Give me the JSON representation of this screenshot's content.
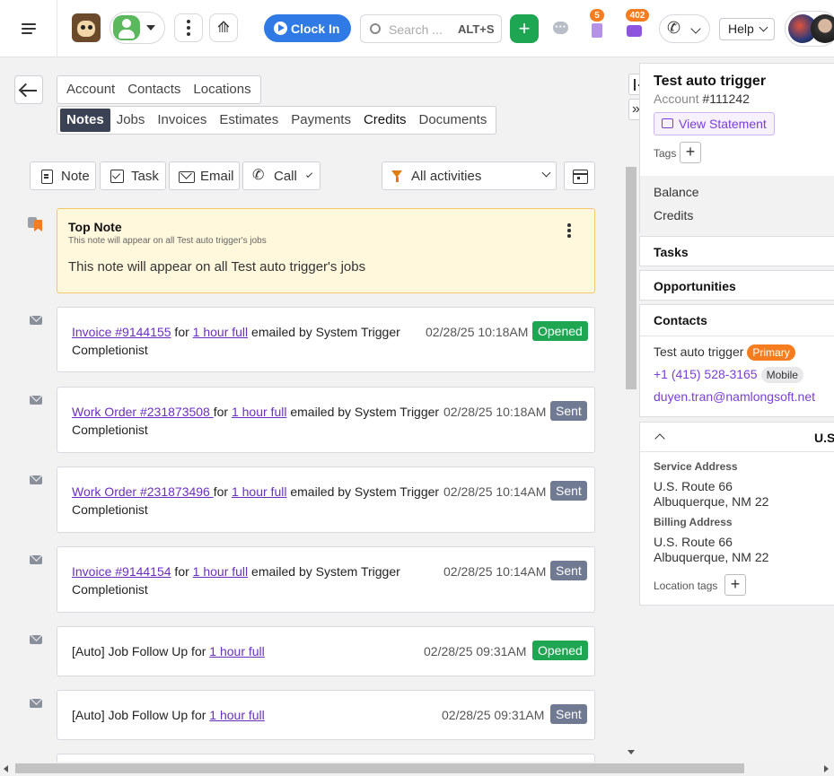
{
  "header": {
    "search_placeholder": "Search ...",
    "search_shortcut": "ALT+S",
    "clock_in": "Clock In",
    "tasks_badge": "5",
    "inbox_badge": "402",
    "help": "Help"
  },
  "tabs_primary": [
    "Account",
    "Contacts",
    "Locations"
  ],
  "tabs_secondary": [
    "Notes",
    "Jobs",
    "Invoices",
    "Estimates",
    "Payments",
    "Credits",
    "Documents"
  ],
  "actions": {
    "note": "Note",
    "task": "Task",
    "email": "Email",
    "call": "Call",
    "filter": "All activities"
  },
  "top_note": {
    "title": "Top Note",
    "subtitle": "This note will appear on all Test auto trigger's jobs",
    "body": "This note will appear on all Test auto trigger's jobs"
  },
  "activities": [
    {
      "link": "Invoice #9144155",
      "for": " for ",
      "link2": "1 hour full",
      "rest": " emailed by System Trigger",
      "line2": "Completionist",
      "time": "02/28/25 10:18AM",
      "status": "Opened"
    },
    {
      "link": "Work Order #231873508 ",
      "for": "for ",
      "link2": "1 hour full",
      "rest": " emailed by System Trigger",
      "line2": "Completionist",
      "time": "02/28/25 10:18AM",
      "status": "Sent"
    },
    {
      "link": "Work Order #231873496 ",
      "for": "for ",
      "link2": "1 hour full",
      "rest": " emailed by System Trigger",
      "line2": "Completionist",
      "time": "02/28/25 10:14AM",
      "status": "Sent"
    },
    {
      "link": "Invoice #9144154",
      "for": " for ",
      "link2": "1 hour full",
      "rest": " emailed by System Trigger",
      "line2": "Completionist",
      "time": "02/28/25 10:14AM",
      "status": "Sent"
    },
    {
      "prefix": "[Auto] Job Follow Up for ",
      "link2": "1 hour full",
      "time": "02/28/25 09:31AM",
      "status": "Opened"
    },
    {
      "prefix": "[Auto] Job Follow Up for ",
      "link2": "1 hour full",
      "time": "02/28/25 09:31AM",
      "status": "Sent"
    }
  ],
  "right_panel": {
    "name": "Test auto trigger",
    "account_label": "Account",
    "account_number": "#111242",
    "view_statement": "View Statement",
    "tags_label": "Tags",
    "balance_label": "Balance",
    "credits_label": "Credits",
    "tasks_header": "Tasks",
    "opportunities_header": "Opportunities",
    "contacts_header": "Contacts",
    "contact_name": "Test auto trigger",
    "primary_badge": "Primary",
    "phone": "+1 (415) 528-3165",
    "mobile_badge": "Mobile",
    "email": "duyen.tran@namlongsoft.net",
    "location_header": "U.S",
    "service_address_label": "Service Address",
    "service_line1": "U.S. Route 66",
    "service_line2": "Albuquerque, NM 22",
    "billing_address_label": "Billing Address",
    "billing_line1": "U.S. Route 66",
    "billing_line2": "Albuquerque, NM 22",
    "location_tags_label": "Location tags"
  }
}
